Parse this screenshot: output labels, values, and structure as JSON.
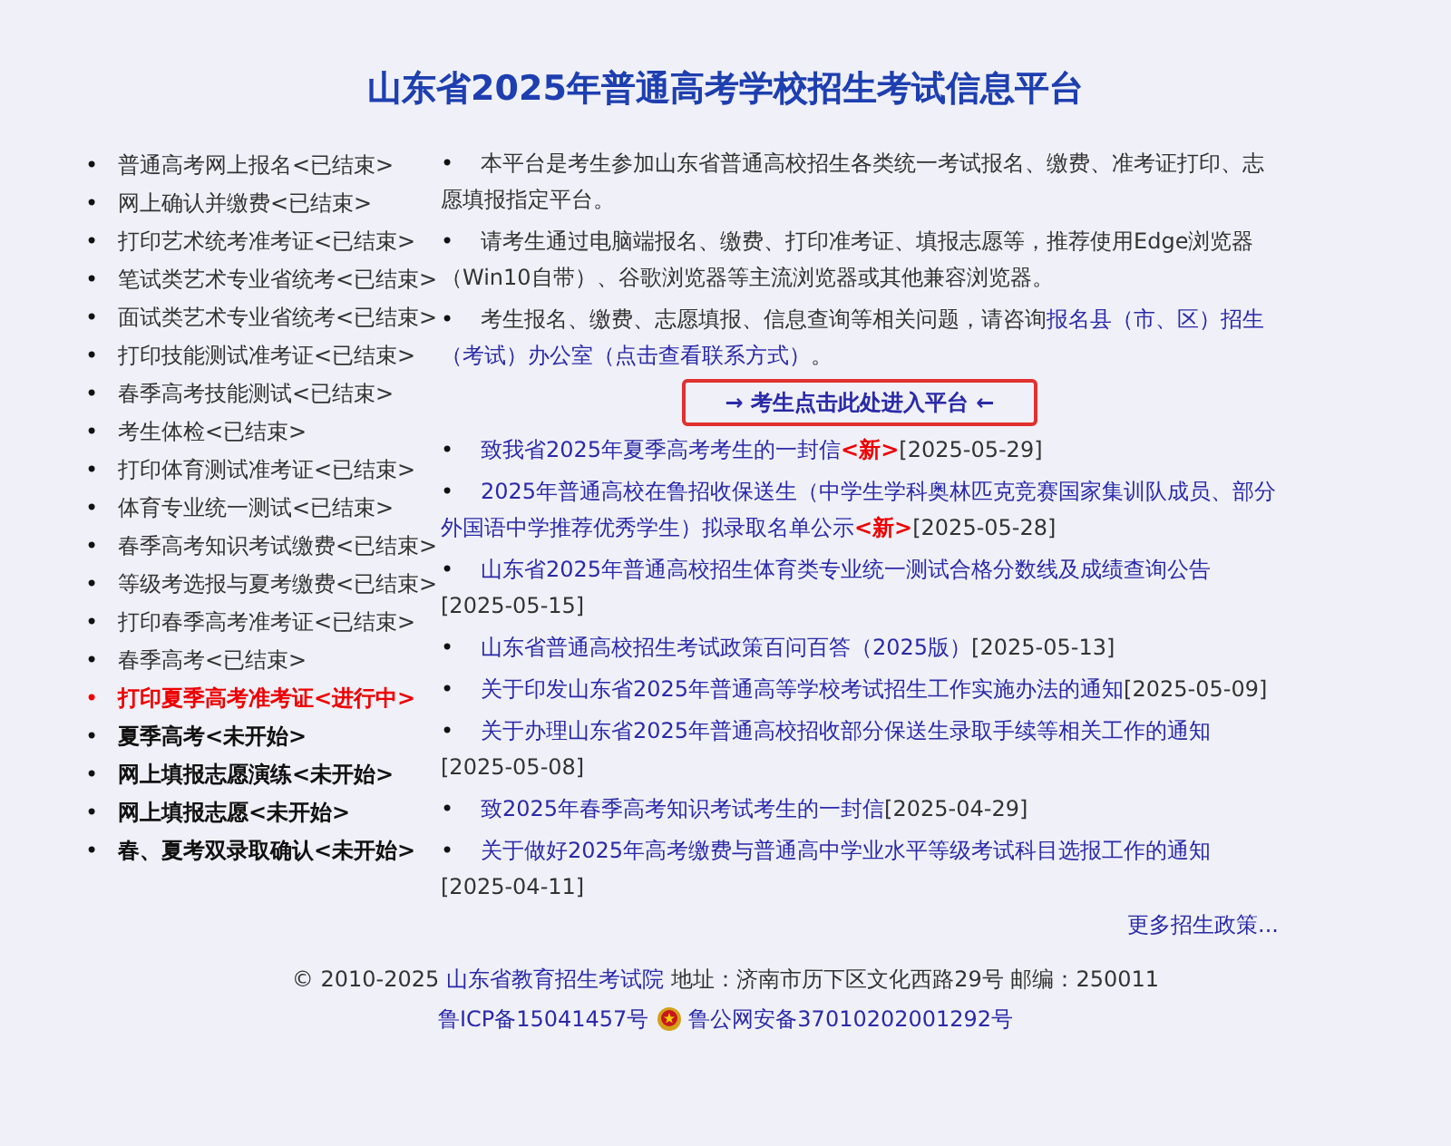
{
  "title": "山东省2025年普通高考学校招生考试信息平台",
  "list_marker": "•",
  "steps": [
    {
      "label": "普通高考网上报名<已结束>",
      "kind": "ended"
    },
    {
      "label": "网上确认并缴费<已结束>",
      "kind": "ended"
    },
    {
      "label": "打印艺术统考准考证<已结束>",
      "kind": "ended"
    },
    {
      "label": "笔试类艺术专业省统考<已结束>",
      "kind": "ended"
    },
    {
      "label": "面试类艺术专业省统考<已结束>",
      "kind": "ended"
    },
    {
      "label": "打印技能测试准考证<已结束>",
      "kind": "ended"
    },
    {
      "label": "春季高考技能测试<已结束>",
      "kind": "ended"
    },
    {
      "label": "考生体检<已结束>",
      "kind": "ended"
    },
    {
      "label": "打印体育测试准考证<已结束>",
      "kind": "ended"
    },
    {
      "label": "体育专业统一测试<已结束>",
      "kind": "ended"
    },
    {
      "label": "春季高考知识考试缴费<已结束>",
      "kind": "ended"
    },
    {
      "label": "等级考选报与夏考缴费<已结束>",
      "kind": "ended"
    },
    {
      "label": "打印春季高考准考证<已结束>",
      "kind": "ended"
    },
    {
      "label": "春季高考<已结束>",
      "kind": "ended"
    },
    {
      "label": "打印夏季高考准考证<进行中>",
      "kind": "active"
    },
    {
      "label": "夏季高考<未开始>",
      "kind": "pending"
    },
    {
      "label": "网上填报志愿演练<未开始>",
      "kind": "pending"
    },
    {
      "label": "网上填报志愿<未开始>",
      "kind": "pending"
    },
    {
      "label": "春、夏考双录取确认<未开始>",
      "kind": "pending"
    }
  ],
  "intro": [
    {
      "text": "本平台是考生参加山东省普通高校招生各类统一考试报名、缴费、准考证打印、志愿填报指定平台。"
    },
    {
      "text": "请考生通过电脑端报名、缴费、打印准考证、填报志愿等，推荐使用Edge浏览器（Win10自带）、谷歌浏览器等主流浏览器或其他兼容浏览器。"
    },
    {
      "text": "考生报名、缴费、志愿填报、信息查询等相关问题，请咨询",
      "links": [
        "报名县（市、区）招生",
        "（考试）办公室（点击查看联系方式）"
      ],
      "after": "。"
    }
  ],
  "enter_button": "→ 考生点击此处进入平台 ←",
  "notices": [
    {
      "title": "致我省2025年夏季高考考生的一封信",
      "new_tag": "<新>",
      "date": "[2025-05-29]"
    },
    {
      "title": "2025年普通高校在鲁招收保送生（中学生学科奥林匹克竞赛国家集训队成员、部分外国语中学推荐优秀学生）拟录取名单公示",
      "new_tag": "<新>",
      "date": "[2025-05-28]"
    },
    {
      "title": "山东省2025年普通高校招生体育类专业统一测试合格分数线及成绩查询公告",
      "date": "[2025-05-15]"
    },
    {
      "title": "山东省普通高校招生考试政策百问百答（2025版）",
      "date": "[2025-05-13]"
    },
    {
      "title": "关于印发山东省2025年普通高等学校考试招生工作实施办法的通知",
      "date": "[2025-05-09]"
    },
    {
      "title": "关于办理山东省2025年普通高校招收部分保送生录取手续等相关工作的通知",
      "date": "[2025-05-08]"
    },
    {
      "title": "致2025年春季高考知识考试考生的一封信",
      "date": "[2025-04-29]"
    },
    {
      "title": "关于做好2025年高考缴费与普通高中学业水平等级考试科目选报工作的通知",
      "date": "[2025-04-11]"
    }
  ],
  "more_link": "更多招生政策...",
  "footer": {
    "copyright": "© 2010-2025",
    "org_link": "山东省教育招生考试院",
    "address": "地址：济南市历下区文化西路29号 邮编：250011",
    "icp_link": "鲁ICP备15041457号",
    "police_link": "鲁公网安备37010202001292号"
  }
}
